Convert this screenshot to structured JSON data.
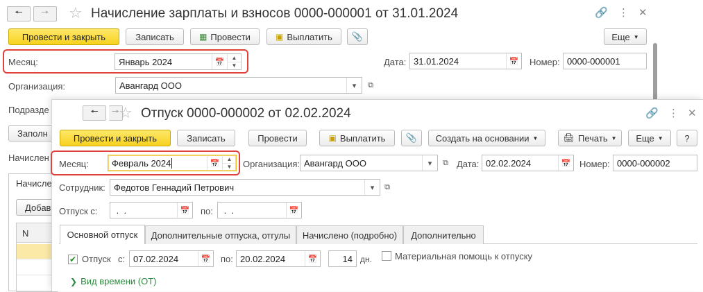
{
  "back_window": {
    "title": "Начисление зарплаты и взносов 0000-000001 от 31.01.2024",
    "toolbar": {
      "post_close": "Провести и закрыть",
      "save": "Записать",
      "post": "Провести",
      "pay": "Выплатить",
      "more": "Еще"
    },
    "month_label": "Месяц:",
    "month_value": "Январь 2024",
    "date_label": "Дата:",
    "date_value": "31.01.2024",
    "number_label": "Номер:",
    "number_value": "0000-000001",
    "org_label": "Организация:",
    "org_value": "Авангард ООО",
    "dept_label_partial": "Подразде",
    "fill_btn_partial": "Заполн",
    "accrued_label_partial": "Начислен",
    "tab_partial": "Начисле",
    "add_btn_partial": "Добав",
    "grid_col_n": "N"
  },
  "front_window": {
    "title": "Отпуск 0000-000002 от 02.02.2024",
    "toolbar": {
      "post_close": "Провести и закрыть",
      "save": "Записать",
      "post": "Провести",
      "pay": "Выплатить",
      "create_based": "Создать на основании",
      "print": "Печать",
      "more": "Еще",
      "help": "?"
    },
    "month_label": "Месяц:",
    "month_value": "Февраль 2024",
    "org_label": "Организация:",
    "org_value": "Авангард ООО",
    "date_label": "Дата:",
    "date_value": "02.02.2024",
    "number_label": "Номер:",
    "number_value": "0000-000002",
    "employee_label": "Сотрудник:",
    "employee_value": "Федотов Геннадий Петрович",
    "leave_from_label": "Отпуск с:",
    "leave_from_value": " .  .",
    "leave_to_label": "по:",
    "leave_to_value": " .  .",
    "tabs": [
      "Основной отпуск",
      "Дополнительные отпуска, отгулы",
      "Начислено (подробно)",
      "Дополнительно"
    ],
    "main_leave": {
      "checkbox_label": "Отпуск",
      "from_label": "с:",
      "from_value": "07.02.2024",
      "to_label": "по:",
      "to_value": "20.02.2024",
      "days_value": "14",
      "days_unit": "дн.",
      "material_aid_label": "Материальная помощь к отпуску",
      "time_type_label": "Вид времени (ОТ)"
    }
  },
  "colors": {
    "accent_yellow": "#f7d21e",
    "highlight_red": "#e0413a",
    "green_text": "#2b8a3e"
  }
}
